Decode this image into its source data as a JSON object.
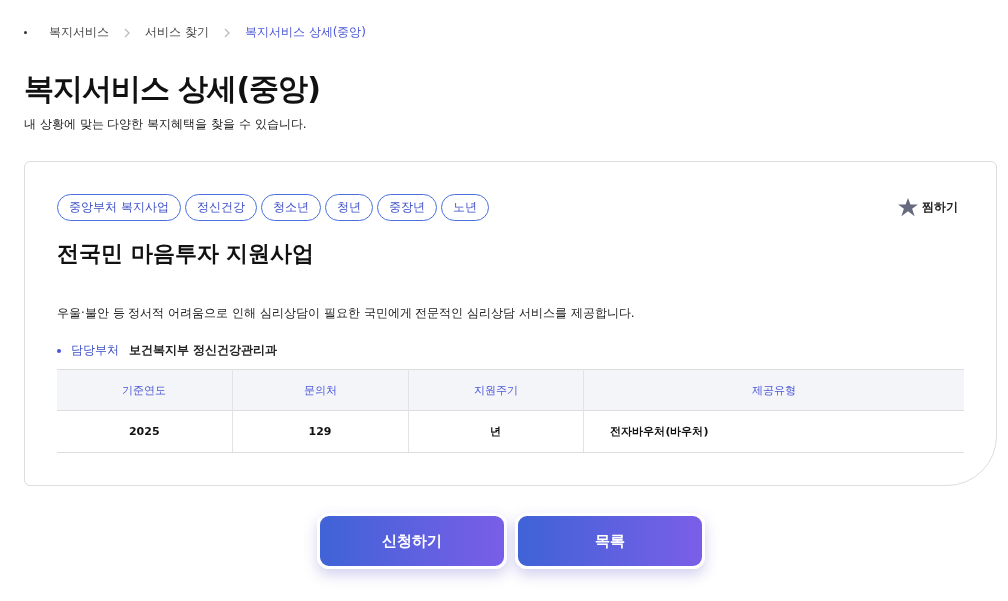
{
  "breadcrumb": [
    {
      "label": "복지서비스",
      "current": false
    },
    {
      "label": "서비스 찾기",
      "current": false
    },
    {
      "label": "복지서비스 상세(중앙)",
      "current": true
    }
  ],
  "page": {
    "title": "복지서비스 상세(중앙)",
    "subtitle": "내 상황에 맞는 다양한 복지혜택을 찾을 수 있습니다."
  },
  "service": {
    "tags": [
      "중앙부처 복지사업",
      "정신건강",
      "청소년",
      "청년",
      "중장년",
      "노년"
    ],
    "favorite": {
      "label": "찜하기",
      "favorited": false
    },
    "name": "전국민 마음투자 지원사업",
    "description": "우울·불안 등 정서적 어려움으로 인해 심리상담이 필요한 국민에게 전문적인 심리상담 서비스를 제공합니다.",
    "department": {
      "label": "담당부처",
      "value": "보건복지부 정신건강관리과"
    },
    "table": {
      "columns": [
        "기준연도",
        "문의처",
        "지원주기",
        "제공유형"
      ],
      "rows": [
        [
          "2025",
          "129",
          "년",
          "전자바우처(바우처)"
        ]
      ]
    }
  },
  "buttons": [
    "신청하기",
    "목록"
  ]
}
